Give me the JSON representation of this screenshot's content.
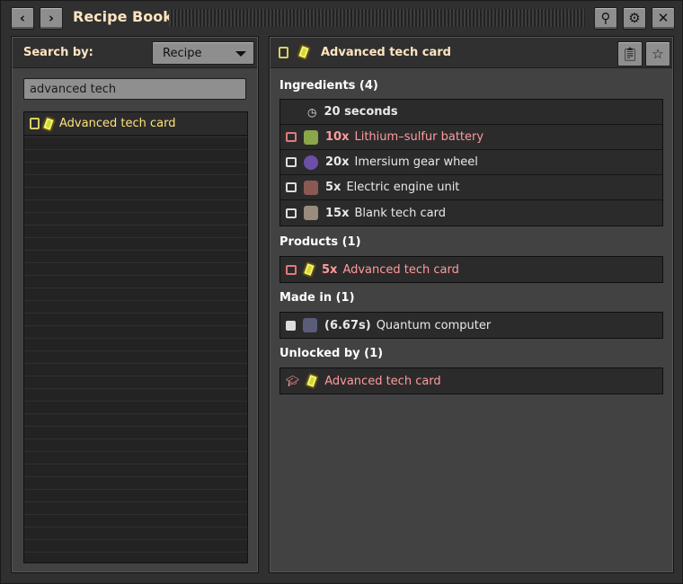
{
  "window": {
    "title": "Recipe Book",
    "back_icon": "chevron-left-icon",
    "forward_icon": "chevron-right-icon",
    "pin_icon": "pin-icon",
    "settings_icon": "gear-icon",
    "close_icon": "close-icon"
  },
  "left": {
    "search_by_label": "Search by:",
    "search_by_value": "Recipe",
    "search_value": "advanced tech",
    "results": [
      {
        "label": "Advanced tech card"
      }
    ]
  },
  "right": {
    "header_title": "Advanced tech card",
    "ingredients_title": "Ingredients (4)",
    "time_label": "20 seconds",
    "ingredients": [
      {
        "amount": "10x",
        "name": "Lithium–sulfur battery",
        "missing": true
      },
      {
        "amount": "20x",
        "name": "Imersium gear wheel",
        "missing": false
      },
      {
        "amount": "5x",
        "name": "Electric engine unit",
        "missing": false
      },
      {
        "amount": "15x",
        "name": "Blank tech card",
        "missing": false
      }
    ],
    "products_title": "Products (1)",
    "products": [
      {
        "amount": "5x",
        "name": "Advanced tech card",
        "missing": true
      }
    ],
    "made_in_title": "Made in (1)",
    "made_in": [
      {
        "time": "(6.67s)",
        "name": "Quantum computer"
      }
    ],
    "unlocked_by_title": "Unlocked by (1)",
    "unlocked_by": [
      {
        "name": "Advanced tech card"
      }
    ]
  },
  "colors": {
    "accent_title": "#ffe6c0",
    "result_text": "#ffe279",
    "missing_text": "#ff9b9b"
  }
}
